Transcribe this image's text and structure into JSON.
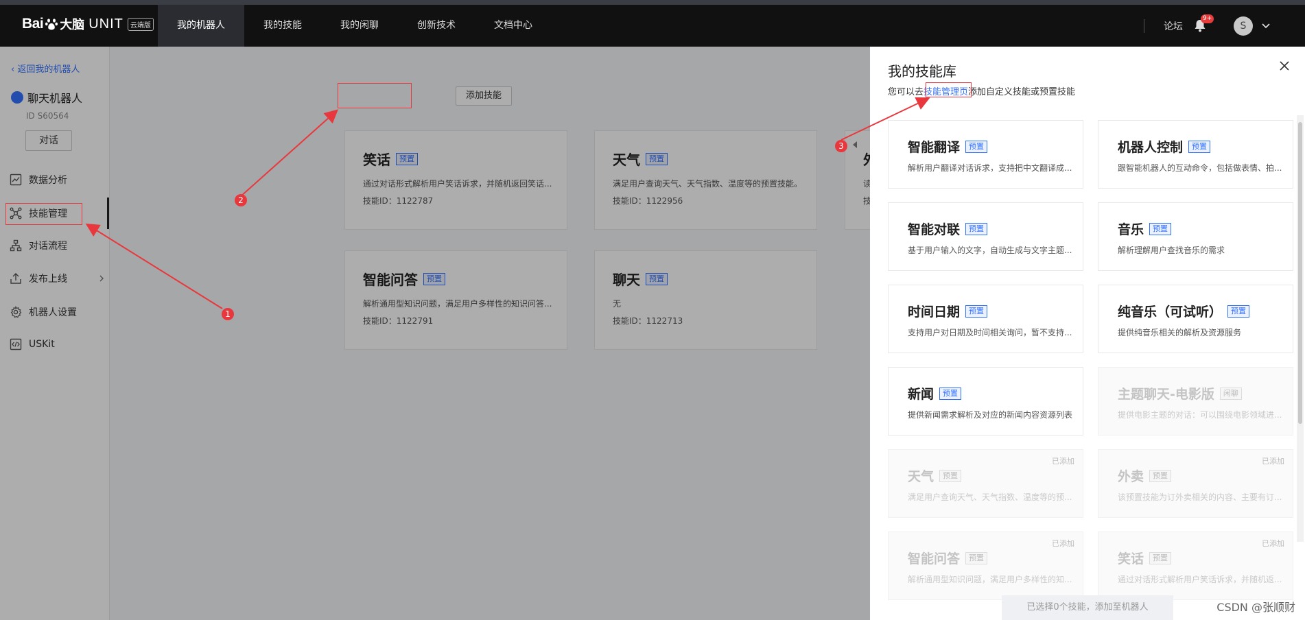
{
  "topbar": {
    "logo_bai": "Bai",
    "logo_du": "du",
    "logo_dn": "大脑",
    "logo_unit": "UNIT",
    "logo_badge": "云端版",
    "nav": [
      "我的机器人",
      "我的技能",
      "我的闲聊",
      "创新技术",
      "文档中心"
    ],
    "active_nav": 0,
    "forum": "论坛",
    "bell_badge": "9+",
    "avatar_letter": "S"
  },
  "sidebar": {
    "back": "返回我的机器人",
    "robot_name": "聊天机器人",
    "robot_id": "ID S60564",
    "chat_button": "对话",
    "menu": [
      "数据分析",
      "技能管理",
      "对话流程",
      "发布上线",
      "机器人设置",
      "USKit"
    ],
    "active_menu": 1
  },
  "main": {
    "add_skill": "添加技能",
    "skills": [
      {
        "title": "笑话",
        "tag": "预置",
        "desc": "通过对话形式解析用户笑话诉求，并随机返回笑话...",
        "id": "技能ID：1122787"
      },
      {
        "title": "天气",
        "tag": "预置",
        "desc": "满足用户查询天气、天气指数、温度等的预置技能。",
        "id": "技能ID：1122956"
      },
      {
        "title": "智能问答",
        "tag": "预置",
        "desc": "解析通用型知识问题，满足用户多样性的知识问答...",
        "id": "技能ID：1122791"
      },
      {
        "title": "聊天",
        "tag": "预置",
        "desc": "无",
        "id": "技能ID：1122713"
      }
    ],
    "partial_card": {
      "title": "外",
      "desc": "读",
      "id": "技"
    }
  },
  "drawer": {
    "title": "我的技能库",
    "sub_prefix": "您可以去",
    "sub_link": "技能管理页",
    "sub_suffix": "添加自定义技能或预置技能",
    "cards": [
      {
        "title": "智能翻译",
        "tag": "预置",
        "desc": "解析用户翻译对话诉求，支持把中文翻译成...",
        "disabled": false
      },
      {
        "title": "机器人控制",
        "tag": "预置",
        "desc": "跟智能机器人的互动命令，包括做表情、拍...",
        "disabled": false
      },
      {
        "title": "智能对联",
        "tag": "预置",
        "desc": "基于用户输入的文字，自动生成与文字主题...",
        "disabled": false
      },
      {
        "title": "音乐",
        "tag": "预置",
        "desc": "解析理解用户查找音乐的需求",
        "disabled": false
      },
      {
        "title": "时间日期",
        "tag": "预置",
        "desc": "支持用户对日期及时间相关询问，暂不支持...",
        "disabled": false
      },
      {
        "title": "纯音乐（可试听）",
        "tag": "预置",
        "desc": "提供纯音乐相关的解析及资源服务",
        "disabled": false
      },
      {
        "title": "新闻",
        "tag": "预置",
        "desc": "提供新闻需求解析及对应的新闻内容资源列表",
        "disabled": false
      },
      {
        "title": "主题聊天-电影版",
        "tag": "闲聊",
        "desc": "提供电影主题的对话：可以围绕电影领域进...",
        "disabled": true
      },
      {
        "title": "天气",
        "tag": "预置",
        "desc": "满足用户查询天气、天气指数、温度等的预...",
        "disabled": true,
        "added": "已添加"
      },
      {
        "title": "外卖",
        "tag": "预置",
        "desc": "该预置技能为订外卖相关的内容、主要有订...",
        "disabled": true,
        "added": "已添加"
      },
      {
        "title": "智能问答",
        "tag": "预置",
        "desc": "解析通用型知识问题，满足用户多样性的知...",
        "disabled": true,
        "added": "已添加"
      },
      {
        "title": "笑话",
        "tag": "预置",
        "desc": "通过对话形式解析用户笑话诉求，并随机返...",
        "disabled": true,
        "added": "已添加"
      }
    ],
    "footer": "已选择0个技能，添加至机器人"
  },
  "annotations": [
    "1",
    "2",
    "3"
  ],
  "watermark": "CSDN @张顺财",
  "colors": {
    "accent": "#3370ff",
    "annotation": "#e8383d",
    "topbar": "#111111"
  }
}
